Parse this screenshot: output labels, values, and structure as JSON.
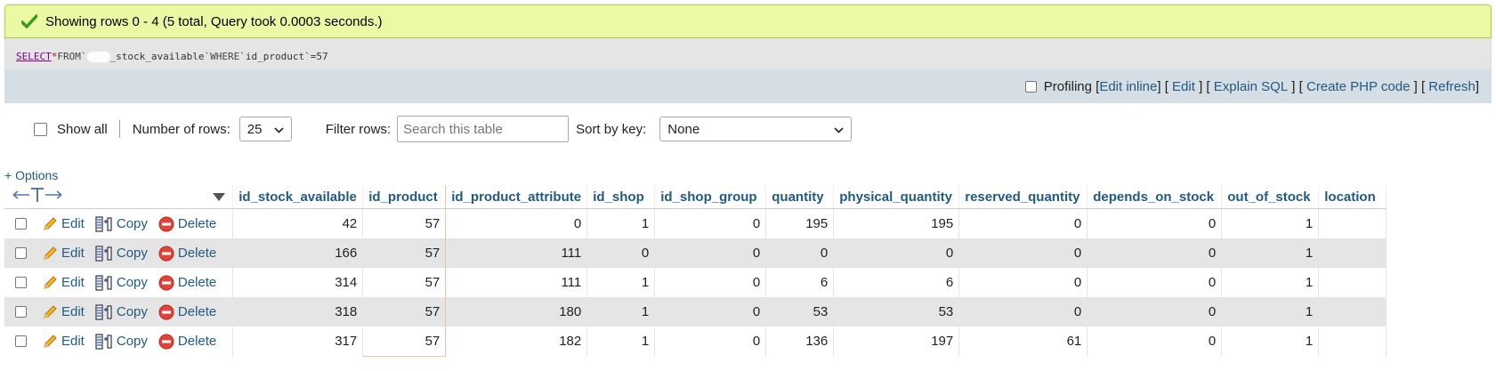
{
  "message": {
    "text": "Showing rows 0 - 4 (5 total, Query took 0.0003 seconds.)",
    "icon": "check-icon",
    "color": "#ebf8a4"
  },
  "sql": {
    "select": "SELECT",
    "star": "*",
    "from": "FROM",
    "table_prefix": "`",
    "table_suffix": "_stock_available`",
    "where": "WHERE",
    "column": "`id_product`",
    "op": "=",
    "value": "57"
  },
  "tools": {
    "profiling": "Profiling",
    "edit_inline": "Edit inline",
    "edit": "Edit",
    "explain": "Explain SQL",
    "create_php": "Create PHP code",
    "refresh": "Refresh"
  },
  "nav": {
    "show_all": "Show all",
    "rows_label": "Number of rows:",
    "rows_value": "25",
    "filter_label": "Filter rows:",
    "filter_placeholder": "Search this table",
    "sort_label": "Sort by key:",
    "sort_value": "None"
  },
  "options_link": "+ Options",
  "columns": [
    "id_stock_available",
    "id_product",
    "id_product_attribute",
    "id_shop",
    "id_shop_group",
    "quantity",
    "physical_quantity",
    "reserved_quantity",
    "depends_on_stock",
    "out_of_stock",
    "location"
  ],
  "actions": {
    "edit": "Edit",
    "copy": "Copy",
    "delete": "Delete"
  },
  "rows": [
    [
      "42",
      "57",
      "0",
      "1",
      "0",
      "195",
      "195",
      "0",
      "0",
      "1",
      ""
    ],
    [
      "166",
      "57",
      "111",
      "0",
      "0",
      "0",
      "0",
      "0",
      "0",
      "1",
      ""
    ],
    [
      "314",
      "57",
      "111",
      "1",
      "0",
      "6",
      "6",
      "0",
      "0",
      "1",
      ""
    ],
    [
      "318",
      "57",
      "180",
      "1",
      "0",
      "53",
      "53",
      "0",
      "0",
      "1",
      ""
    ],
    [
      "317",
      "57",
      "182",
      "1",
      "0",
      "136",
      "197",
      "61",
      "0",
      "1",
      ""
    ]
  ],
  "colors": {
    "link": "#235a81",
    "row_alt": "#e5e5e5",
    "tools_bg": "#d5dde5",
    "highlight_border": "#f2c3a0"
  }
}
